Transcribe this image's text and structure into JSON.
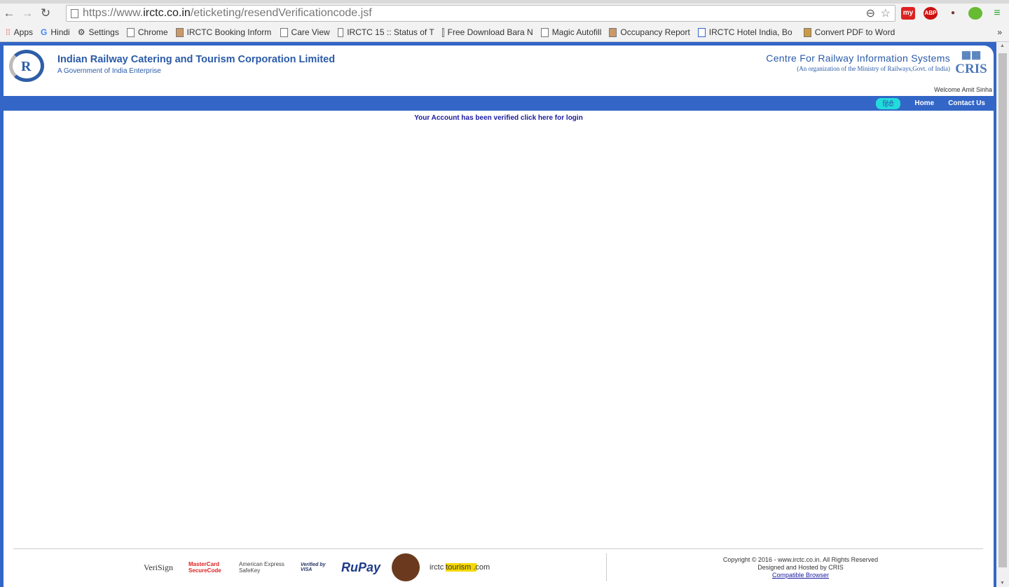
{
  "browser": {
    "url_prefix": "https://www.",
    "url_host": "irctc.co.in",
    "url_path": "/eticketing/resendVerificationcode.jsf",
    "bookmarks": [
      "Apps",
      "Hindi",
      "Settings",
      "Chrome",
      "IRCTC Booking Inform",
      "Care View",
      "IRCTC 15 :: Status of T",
      "Free Download Bara N",
      "Magic Autofill",
      "Occupancy Report",
      "IRCTC Hotel India, Bo",
      "Convert PDF to Word"
    ],
    "extensions": [
      "my",
      "ABP"
    ]
  },
  "header": {
    "org_title": "Indian Railway Catering and Tourism Corporation Limited",
    "org_subtitle": "A Government of India Enterprise",
    "cris_title": "Centre For Railway Information Systems",
    "cris_subtitle": "(An organization of the Ministry of Railways,Govt. of India)",
    "cris_logo": "CRIS",
    "welcome": "Welcome Amit Sinha"
  },
  "nav": {
    "hindi": "हिंदी",
    "home": "Home",
    "contact": "Contact Us"
  },
  "main": {
    "message": "Your Account has been verified click here for login"
  },
  "footer": {
    "logos": [
      "VeriSign",
      "MasterCard SecureCode",
      "American Express SafeKey",
      "Verified by VISA",
      "RuPay",
      "irctc tourism .com"
    ],
    "copyright": "Copyright © 2016 - www.irctc.co.in. All Rights Reserved",
    "designed": "Designed and Hosted by CRIS",
    "compatible": "Compatible Browser"
  },
  "colors": {
    "brand": "#3366c6",
    "title": "#2a5aa8",
    "link": "#1a1aa0",
    "hindi_bg": "#22dcdc"
  }
}
